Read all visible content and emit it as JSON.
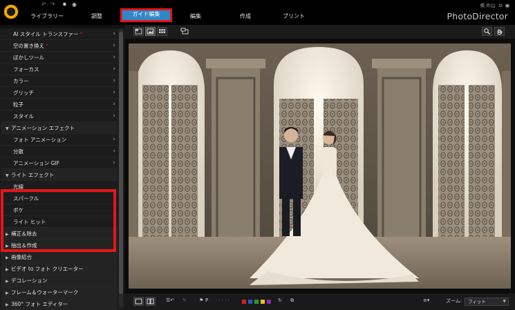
{
  "top": {
    "tabs": [
      {
        "label": "ライブラリー"
      },
      {
        "label": "調整"
      },
      {
        "label": "ガイド編集"
      },
      {
        "label": "編集"
      },
      {
        "label": "作成"
      },
      {
        "label": "プリント"
      }
    ],
    "active_tab": "ガイド編集",
    "user": "侑 片山",
    "brand": "PhotoDirector"
  },
  "left_panel": {
    "items": [
      {
        "label": "AI スタイル トランスファー",
        "type": "item",
        "badge": "*"
      },
      {
        "label": "空の置き換え",
        "type": "item",
        "badge": "*"
      },
      {
        "label": "ぼかしツール",
        "type": "item"
      },
      {
        "label": "フォーカス",
        "type": "item"
      },
      {
        "label": "カラー",
        "type": "item"
      },
      {
        "label": "グリッチ",
        "type": "item"
      },
      {
        "label": "粒子",
        "type": "item"
      },
      {
        "label": "スタイル",
        "type": "item"
      },
      {
        "label": "アニメーション エフェクト",
        "type": "section-open"
      },
      {
        "label": "フォト アニメーション",
        "type": "item"
      },
      {
        "label": "分散",
        "type": "item"
      },
      {
        "label": "アニメーション GIF",
        "type": "item"
      },
      {
        "label": "ライト エフェクト",
        "type": "section-open"
      },
      {
        "label": "光線",
        "type": "sub"
      },
      {
        "label": "スパークル",
        "type": "sub"
      },
      {
        "label": "ボケ",
        "type": "sub"
      },
      {
        "label": "ライト ヒット",
        "type": "sub"
      },
      {
        "label": "補正＆除去",
        "type": "section"
      },
      {
        "label": "抽出＆作成",
        "type": "section"
      },
      {
        "label": "画像結合",
        "type": "section"
      },
      {
        "label": "ビデオ to フォト クリエーター",
        "type": "section"
      },
      {
        "label": "デコレーション",
        "type": "section"
      },
      {
        "label": "フレーム＆ウォーターマーク",
        "type": "section"
      },
      {
        "label": "360° フォト エディター",
        "type": "section"
      }
    ]
  },
  "bottom": {
    "flag_label": "P",
    "dots": "· · · · ·",
    "zoom_label": "ズーム:",
    "zoom_value": "フィット",
    "colors": [
      "#d62020",
      "#2a55c8",
      "#2c9a2c",
      "#e8c21a",
      "#8a2bb8"
    ]
  },
  "colors": {
    "accent": "#2f87c8",
    "highlight": "#e8141a"
  }
}
